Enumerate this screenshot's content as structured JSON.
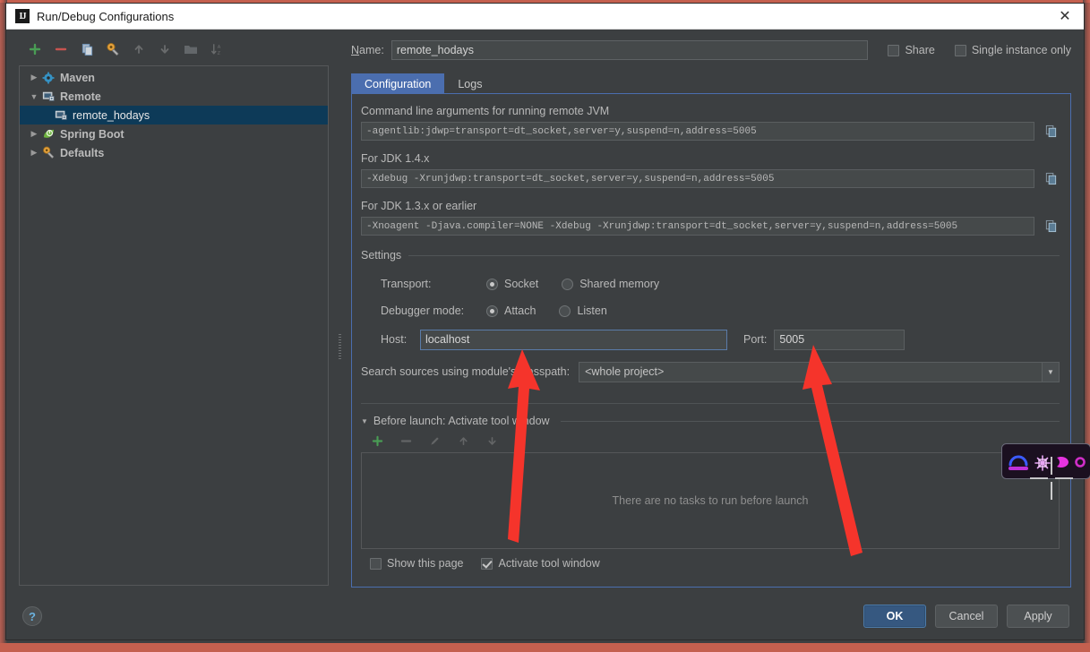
{
  "window": {
    "title": "Run/Debug Configurations",
    "app_icon": "IJ",
    "close_label": "✕"
  },
  "tree_toolbar": {
    "buttons": [
      {
        "name": "add-configuration-button",
        "icon": "plus-icon",
        "enabled": true
      },
      {
        "name": "remove-configuration-button",
        "icon": "minus-icon",
        "enabled": true
      },
      {
        "name": "copy-configuration-button",
        "icon": "copy-icon",
        "enabled": true
      },
      {
        "name": "edit-templates-button",
        "icon": "wrench-icon",
        "enabled": true
      },
      {
        "name": "move-up-button",
        "icon": "arrow-up-icon",
        "enabled": false
      },
      {
        "name": "move-down-button",
        "icon": "arrow-down-icon",
        "enabled": false
      },
      {
        "name": "create-folder-button",
        "icon": "folder-icon",
        "enabled": false
      },
      {
        "name": "sort-configurations-button",
        "icon": "sort-az-icon",
        "enabled": false
      }
    ]
  },
  "tree": {
    "nodes": [
      {
        "label": "Maven",
        "icon": "maven-icon",
        "twisty": "▶",
        "level": 0,
        "selected": false
      },
      {
        "label": "Remote",
        "icon": "remote-icon",
        "twisty": "▼",
        "level": 0,
        "selected": false
      },
      {
        "label": "remote_hodays",
        "icon": "remote-icon",
        "twisty": "",
        "level": 1,
        "selected": true
      },
      {
        "label": "Spring Boot",
        "icon": "spring-boot-icon",
        "twisty": "▶",
        "level": 0,
        "selected": false
      },
      {
        "label": "Defaults",
        "icon": "defaults-icon",
        "twisty": "▶",
        "level": 0,
        "selected": false
      }
    ]
  },
  "header": {
    "name_label": "Name:",
    "name_value": "remote_hodays",
    "share_label": "Share",
    "share_checked": false,
    "single_instance_label": "Single instance only",
    "single_instance_checked": false
  },
  "tabs": [
    {
      "label": "Configuration",
      "active": true
    },
    {
      "label": "Logs",
      "active": false
    }
  ],
  "jvm_args": {
    "section_label": "Command line arguments for running remote JVM",
    "value": "-agentlib:jdwp=transport=dt_socket,server=y,suspend=n,address=5005",
    "jdk14_label": "For JDK 1.4.x",
    "jdk14_value": "-Xdebug -Xrunjdwp:transport=dt_socket,server=y,suspend=n,address=5005",
    "jdk13_label": "For JDK 1.3.x or earlier",
    "jdk13_value": "-Xnoagent -Djava.compiler=NONE -Xdebug -Xrunjdwp:transport=dt_socket,server=y,suspend=n,address=5005",
    "copy_icon": "copy-to-clipboard-icon"
  },
  "settings": {
    "group_label": "Settings",
    "transport_label": "Transport:",
    "transport_options": [
      {
        "label": "Socket",
        "selected": true
      },
      {
        "label": "Shared memory",
        "selected": false
      }
    ],
    "debugger_mode_label": "Debugger mode:",
    "debugger_mode_options": [
      {
        "label": "Attach",
        "selected": true
      },
      {
        "label": "Listen",
        "selected": false
      }
    ],
    "host_label": "Host:",
    "host_value": "localhost",
    "port_label": "Port:",
    "port_value": "5005",
    "search_sources_label": "Search sources using module's classpath:",
    "search_sources_value": "<whole project>",
    "dropdown_arrow": "▼"
  },
  "before_launch": {
    "header": "Before launch: Activate tool window",
    "twisty": "▼",
    "toolbar": [
      {
        "name": "add-task-button",
        "icon": "plus-icon",
        "enabled": true
      },
      {
        "name": "remove-task-button",
        "icon": "minus-icon",
        "enabled": false
      },
      {
        "name": "edit-task-button",
        "icon": "pencil-icon",
        "enabled": false
      },
      {
        "name": "move-task-up-button",
        "icon": "arrow-up-icon",
        "enabled": false
      },
      {
        "name": "move-task-down-button",
        "icon": "arrow-down-icon",
        "enabled": false
      }
    ],
    "empty_text": "There are no tasks to run before launch",
    "show_this_page_label": "Show this page",
    "show_this_page_checked": false,
    "activate_tool_window_label": "Activate tool window",
    "activate_tool_window_checked": true
  },
  "footer": {
    "help_label": "?",
    "ok_label": "OK",
    "cancel_label": "Cancel",
    "apply_label": "Apply"
  },
  "annotations": {
    "arrow_color": "#f5342b",
    "host_arrow": "points-to-host-field",
    "port_arrow": "points-to-port-field"
  },
  "overlay": {
    "widget_name": "libra-zodiac-neon-overlay",
    "cursor_name": "crosshair-cursor"
  },
  "colors": {
    "accent": "#4b6eaf",
    "selection": "#0d3a58",
    "panel_bg": "#3c3f41",
    "field_bg": "#45494a",
    "primary_button": "#365880",
    "annotation_red": "#f5342b"
  }
}
